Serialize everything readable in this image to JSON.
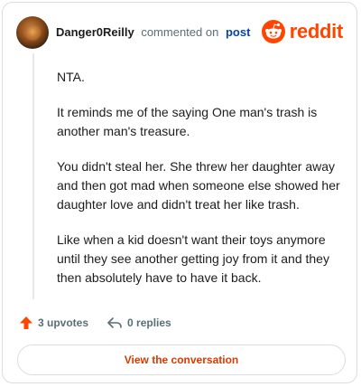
{
  "header": {
    "username": "Danger0Reilly",
    "action_text": "commented on",
    "post_link": "post",
    "brand": "reddit"
  },
  "comment": {
    "paragraphs": [
      "NTA.",
      "It reminds me of the saying One man's trash is another man's treasure.",
      "You didn't steal her. She threw her daughter away and then got mad when someone else showed her daughter love and didn't treat her like trash.",
      "Like when a kid doesn't want their toys anymore until they see another getting joy from it and they then absolutely have to have it back."
    ]
  },
  "actions": {
    "upvotes": "3 upvotes",
    "replies": "0 replies"
  },
  "view_button": "View the conversation",
  "colors": {
    "accent": "#ff4500",
    "link": "#0a449b",
    "muted": "#576f76",
    "border": "#d9dde0",
    "button_text": "#d93a00"
  },
  "icons": [
    "avatar",
    "reddit-logo-icon",
    "upvote-arrow-icon",
    "reply-icon"
  ]
}
